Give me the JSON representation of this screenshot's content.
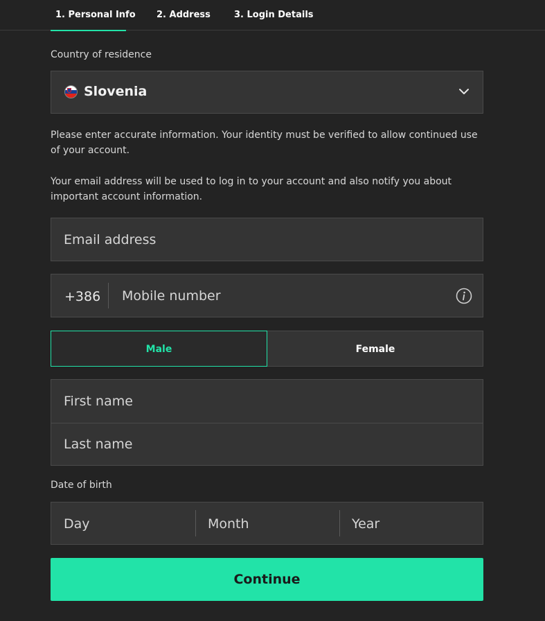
{
  "tabs": [
    {
      "label": "1.  Personal Info",
      "active": true
    },
    {
      "label": "2.  Address",
      "active": false
    },
    {
      "label": "3.  Login Details",
      "active": false
    }
  ],
  "country": {
    "label": "Country of residence",
    "value": "Slovenia",
    "flag_icon": "slovenia-flag-icon"
  },
  "info": {
    "paragraph_1": "Please enter accurate information. Your identity must be verified to allow continued use of your account.",
    "paragraph_2": "Your email address will be used to log in to your account and also notify you about important account information."
  },
  "email": {
    "placeholder": "Email address"
  },
  "mobile": {
    "prefix": "+386",
    "placeholder": "Mobile number",
    "icon": "info-icon"
  },
  "gender": {
    "male": "Male",
    "female": "Female",
    "selected": "Male"
  },
  "name": {
    "first_placeholder": "First name",
    "last_placeholder": "Last name"
  },
  "dob": {
    "label": "Date of birth",
    "day": "Day",
    "month": "Month",
    "year": "Year"
  },
  "continue_label": "Continue",
  "colors": {
    "accent": "#22e3a8",
    "background": "#232323",
    "field": "#343434"
  }
}
